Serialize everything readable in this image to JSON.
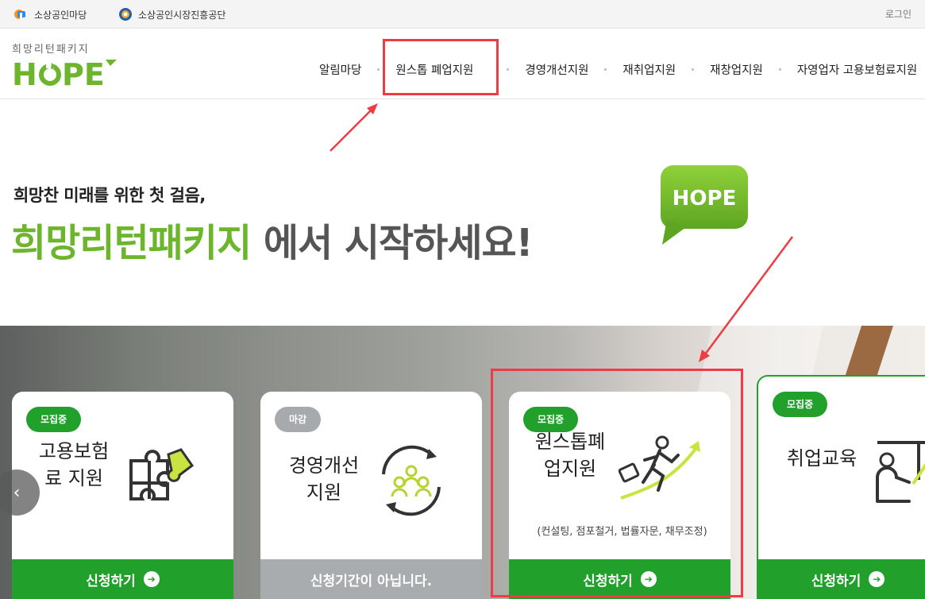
{
  "topbar": {
    "links": [
      {
        "label": "소상공인마당",
        "icon": "sosang-logo-icon"
      },
      {
        "label": "소상공인시장진흥공단",
        "icon": "semas-logo-icon"
      }
    ],
    "login_label": "로그인"
  },
  "header": {
    "logo_sub": "희망리턴패키지",
    "logo_main": "HOPE",
    "nav": [
      {
        "label": "알림마당"
      },
      {
        "label": "원스톱 폐업지원"
      },
      {
        "label": "경영개선지원"
      },
      {
        "label": "재취업지원"
      },
      {
        "label": "재창업지원"
      },
      {
        "label": "자영업자 고용보험료지원"
      }
    ]
  },
  "hero": {
    "subtitle": "희망찬 미래를 위한 첫 걸음,",
    "title_highlight": "희망리턴패키지",
    "title_rest": " 에서 시작하세요!",
    "bubble_text": "HOPE"
  },
  "cards": [
    {
      "badge": "모집중",
      "title": "고용보험료 지원",
      "button": "신청하기",
      "icon": "puzzle-icon",
      "status": "open"
    },
    {
      "badge": "마감",
      "title": "경영개선지원",
      "button": "신청기간이 아닙니다.",
      "icon": "team-cycle-icon",
      "status": "closed"
    },
    {
      "badge": "모집중",
      "title": "원스톱폐업지원",
      "note": "(컨설팅, 점포철거, 법률자문, 채무조정)",
      "button": "신청하기",
      "icon": "running-person-icon",
      "status": "open"
    },
    {
      "badge": "모집중",
      "title": "취업교육",
      "button": "신청하기",
      "icon": "lecture-icon",
      "status": "open"
    }
  ],
  "colors": {
    "brand_green": "#6cb52d",
    "button_green": "#21a02c",
    "closed_gray": "#a8acaf",
    "highlight_red": "#ef3b44"
  }
}
